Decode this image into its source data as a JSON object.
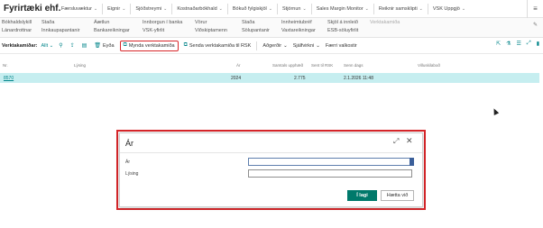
{
  "company": "Fyrirtæki ehf.",
  "topnav": [
    "Færsluvæktur",
    "Eignir",
    "Sjóðstreymi",
    "Kostnaðarbókhald",
    "Bókuð fylgiskjöl",
    "Stjórnun",
    "Sales Margin Monitor",
    "Reiknir samsklipti",
    "VSK Uppgjö"
  ],
  "subnav": [
    {
      "label": "Bókhaldslykill",
      "dim": false
    },
    {
      "label": "Lánardrottnar",
      "dim": false
    },
    {
      "label": "Staða",
      "dim": false
    },
    {
      "label": "Innkaupapantanir",
      "dim": false
    },
    {
      "label": "Áætlun",
      "dim": false
    },
    {
      "label": "Bankareikningar",
      "dim": false
    },
    {
      "label": "Innborgun í banka",
      "dim": false
    },
    {
      "label": "VSK-yfirlit",
      "dim": false
    },
    {
      "label": "Vörur",
      "dim": false
    },
    {
      "label": "Viðskiptamenn",
      "dim": false
    },
    {
      "label": "Staða",
      "dim": false
    },
    {
      "label": "Sölupantanir",
      "dim": false
    },
    {
      "label": "Innheimtubréf",
      "dim": false
    },
    {
      "label": "Vaxtareikningar",
      "dim": false
    },
    {
      "label": "Skjöl á innleið",
      "dim": false
    },
    {
      "label": "ESB-söluyfirlit",
      "dim": false
    },
    {
      "label": "Verktakamiða",
      "dim": true
    }
  ],
  "actionbar": {
    "title": "Verktakamiðar:",
    "filter": "Allt",
    "delete_label": "Eyða",
    "create_label": "Mynda verktakamiða",
    "send_label": "Senda verktakamiða til RSK",
    "actions_label": "Aðgerðir",
    "related_label": "Sjálfvirkni",
    "fewer_label": "Færri valkostir"
  },
  "table": {
    "headers": [
      "Nr.",
      "Lýsing",
      "Ár",
      "Samtals upphæð",
      "Sent til RSK",
      "Senn dags",
      "Villuskilaboð"
    ],
    "rows": [
      {
        "nr": "8570",
        "desc": "",
        "year": "2024",
        "amount": "2.775",
        "sent": "",
        "date": "2.1.2026 11:48",
        "error": ""
      }
    ]
  },
  "dialog": {
    "title": "Ár",
    "field1_label": "Ár",
    "field1_value": "",
    "field2_label": "Lýsing",
    "field2_value": "",
    "ok_label": "Í lagi",
    "cancel_label": "Hætta við"
  }
}
